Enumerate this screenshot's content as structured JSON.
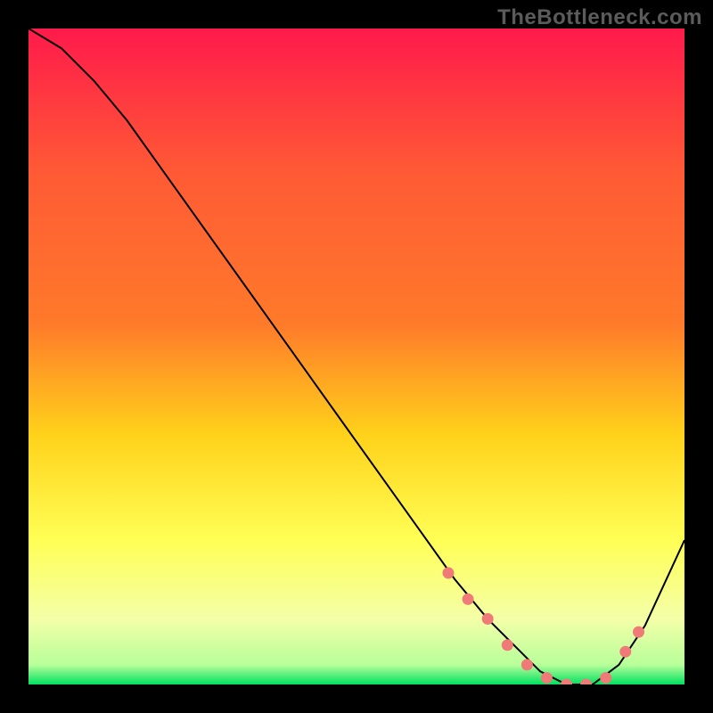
{
  "watermark": "TheBottleneck.com",
  "colors": {
    "frame": "#000000",
    "gradient_top": "#ff1a4b",
    "gradient_upper_mid": "#ff7a2a",
    "gradient_mid": "#ffd21a",
    "gradient_lower_mid": "#ffff55",
    "gradient_low": "#f4ffa8",
    "gradient_bottom": "#00e060",
    "curve": "#000000",
    "dots": "#ef7a77"
  },
  "chart_data": {
    "type": "line",
    "title": "",
    "xlabel": "",
    "ylabel": "",
    "ylim": [
      0,
      100
    ],
    "xlim": [
      0,
      100
    ],
    "annotations": [],
    "legend": [],
    "series": [
      {
        "name": "bottleneck-curve",
        "x": [
          0,
          5,
          10,
          15,
          20,
          25,
          30,
          35,
          40,
          45,
          50,
          55,
          60,
          65,
          70,
          75,
          78,
          82,
          86,
          90,
          94,
          100
        ],
        "y": [
          100,
          97,
          92,
          86,
          79,
          72,
          65,
          58,
          51,
          44,
          37,
          30,
          23,
          16,
          10,
          5,
          2,
          0,
          0,
          3,
          9,
          22
        ]
      }
    ],
    "markers": {
      "name": "highlight-dots",
      "x": [
        64,
        67,
        70,
        73,
        76,
        79,
        82,
        85,
        88,
        91,
        93
      ],
      "y": [
        17,
        13,
        10,
        6,
        3,
        1,
        0,
        0,
        1,
        5,
        8
      ]
    }
  }
}
